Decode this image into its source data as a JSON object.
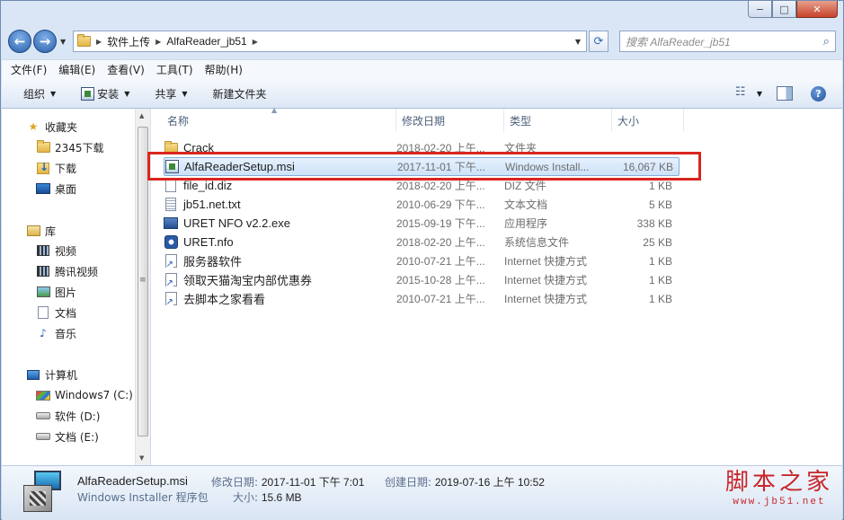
{
  "window": {
    "caption_minimize": "−",
    "caption_maximize": "□",
    "caption_close": "✕"
  },
  "address": {
    "segments": [
      "软件上传",
      "AlfaReader_jb51"
    ],
    "search_placeholder": "搜索 AlfaReader_jb51"
  },
  "menu": [
    "文件(F)",
    "编辑(E)",
    "查看(V)",
    "工具(T)",
    "帮助(H)"
  ],
  "toolbar": {
    "organize": "组织",
    "install": "安装",
    "share": "共享",
    "new_folder": "新建文件夹"
  },
  "sidebar": {
    "favorites": "收藏夹",
    "favorites_items": [
      "2345下载",
      "下载",
      "桌面"
    ],
    "libraries": "库",
    "library_items": [
      "视频",
      "腾讯视频",
      "图片",
      "文档",
      "音乐"
    ],
    "computer": "计算机",
    "drives": [
      "Windows7 (C:)",
      "软件 (D:)",
      "文档 (E:)"
    ]
  },
  "columns": [
    "名称",
    "修改日期",
    "类型",
    "大小"
  ],
  "files": [
    {
      "name": "Crack",
      "date": "2018-02-20 上午...",
      "type": "文件夹",
      "size": "",
      "icon": "folder-icon"
    },
    {
      "name": "AlfaReaderSetup.msi",
      "date": "2017-11-01 下午...",
      "type": "Windows Install...",
      "size": "16,067 KB",
      "icon": "msi-installer-icon"
    },
    {
      "name": "file_id.diz",
      "date": "2018-02-20 上午...",
      "type": "DIZ 文件",
      "size": "1 KB",
      "icon": "file-icon"
    },
    {
      "name": "jb51.net.txt",
      "date": "2010-06-29 下午...",
      "type": "文本文档",
      "size": "5 KB",
      "icon": "text-file-icon"
    },
    {
      "name": "URET NFO v2.2.exe",
      "date": "2015-09-19 下午...",
      "type": "应用程序",
      "size": "338 KB",
      "icon": "exe-icon"
    },
    {
      "name": "URET.nfo",
      "date": "2018-02-20 上午...",
      "type": "系统信息文件",
      "size": "25 KB",
      "icon": "nfo-icon"
    },
    {
      "name": "服务器软件",
      "date": "2010-07-21 上午...",
      "type": "Internet 快捷方式",
      "size": "1 KB",
      "icon": "shortcut-icon"
    },
    {
      "name": "领取天猫淘宝内部优惠券",
      "date": "2015-10-28 上午...",
      "type": "Internet 快捷方式",
      "size": "1 KB",
      "icon": "shortcut-icon"
    },
    {
      "name": "去脚本之家看看",
      "date": "2010-07-21 上午...",
      "type": "Internet 快捷方式",
      "size": "1 KB",
      "icon": "shortcut-icon"
    }
  ],
  "selected_index": 1,
  "details": {
    "name": "AlfaReaderSetup.msi",
    "type": "Windows Installer 程序包",
    "modified_label": "修改日期:",
    "modified_value": "2017-11-01 下午 7:01",
    "created_label": "创建日期:",
    "created_value": "2019-07-16 上午 10:52",
    "size_label": "大小:",
    "size_value": "15.6 MB"
  },
  "watermark": {
    "title": "脚本之家",
    "url": "www.jb51.net"
  },
  "colors": {
    "highlight_box": "#d9251f",
    "selection": "#cde2f9",
    "accent": "#2a5fa8"
  }
}
